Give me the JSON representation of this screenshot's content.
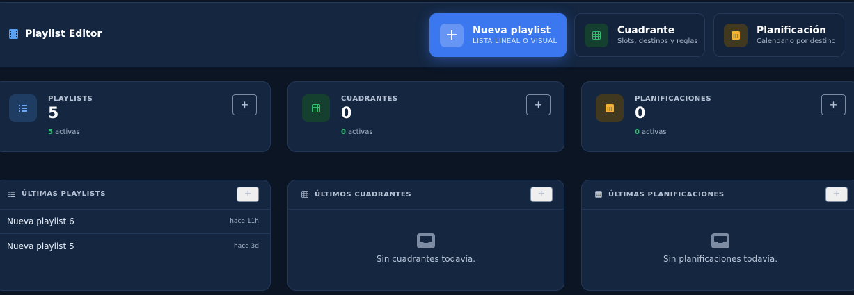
{
  "header": {
    "title": "Playlist Editor",
    "icon": "film-icon"
  },
  "actions": [
    {
      "title": "Nueva playlist",
      "subtitle": "LISTA LINEAL O VISUAL",
      "icon": "plus-icon",
      "symbol": "+"
    },
    {
      "title": "Cuadrante",
      "subtitle": "Slots, destinos y reglas",
      "icon": "grid-icon"
    },
    {
      "title": "Planificación",
      "subtitle": "Calendario por destino",
      "icon": "calendar-icon"
    }
  ],
  "stats": [
    {
      "label": "PLAYLISTS",
      "value": "5",
      "active_count": "5",
      "active_label": "activas",
      "add": "+"
    },
    {
      "label": "CUADRANTES",
      "value": "0",
      "active_count": "0",
      "active_label": "activas",
      "add": "+"
    },
    {
      "label": "PLANIFICACIONES",
      "value": "0",
      "active_count": "0",
      "active_label": "activas",
      "add": "+"
    }
  ],
  "panels": {
    "playlists": {
      "title": "ÚLTIMAS PLAYLISTS",
      "add": "+",
      "items": [
        {
          "name": "Nueva playlist 6",
          "time": "hace 11h"
        },
        {
          "name": "Nueva playlist 5",
          "time": "hace 3d"
        }
      ]
    },
    "cuadrantes": {
      "title": "ÚLTIMOS CUADRANTES",
      "add": "+",
      "empty": "Sin cuadrantes todavía."
    },
    "planificaciones": {
      "title": "ÚLTIMAS PLANIFICACIONES",
      "add": "+",
      "empty": "Sin planificaciones todavía."
    }
  },
  "colors": {
    "primary": "#3b78f0",
    "success": "#2fbf6f",
    "warning": "#f2b233",
    "background": "#0b1524",
    "card": "#142640"
  }
}
